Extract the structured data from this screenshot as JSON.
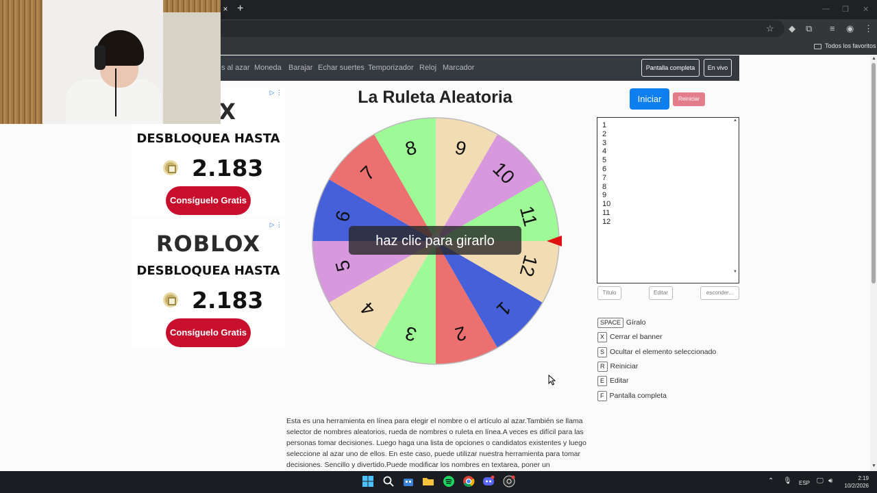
{
  "browser": {
    "new_tab": "+",
    "tab_close": "×",
    "bookmarks_folder": "Todos los favoritos"
  },
  "nav": {
    "links": [
      "s al azar",
      "Moneda",
      "Barajar",
      "Echar suertes",
      "Temporizador",
      "Reloj",
      "Marcador"
    ],
    "fullscreen": "Pantalla completa",
    "live": "En vivo"
  },
  "ads": [
    {
      "brand": "LOX",
      "headline": "DESBLOQUEA HASTA",
      "amount": "2.183",
      "cta": "Consíguelo Gratis"
    },
    {
      "brand": "ROBLOX",
      "headline": "DESBLOQUEA HASTA",
      "amount": "2.183",
      "cta": "Consíguelo Gratis"
    }
  ],
  "main": {
    "title": "La Ruleta Aleatoria",
    "start": "Iniciar",
    "reset": "Reiniciar",
    "overlay": "haz clic para girarlo",
    "entries_text": "1\n2\n3\n4\n5\n6\n7\n8\n9\n10\n11\n12",
    "title_btn": "Título",
    "edit_btn": "Editar",
    "hide_btn": "esconder..."
  },
  "wheel": {
    "segments": [
      {
        "label": "11",
        "color": "#9dfa96"
      },
      {
        "label": "12",
        "color": "#f1dcb4"
      },
      {
        "label": "1",
        "color": "#4560d8"
      },
      {
        "label": "2",
        "color": "#ec7070"
      },
      {
        "label": "3",
        "color": "#9dfa96"
      },
      {
        "label": "4",
        "color": "#f1dcb4"
      },
      {
        "label": "5",
        "color": "#d898de"
      },
      {
        "label": "6",
        "color": "#4560d8"
      },
      {
        "label": "7",
        "color": "#ec7070"
      },
      {
        "label": "8",
        "color": "#9dfa96"
      },
      {
        "label": "9",
        "color": "#f1dcb4"
      },
      {
        "label": "10",
        "color": "#d898de"
      }
    ],
    "pointer_color": "#e01010"
  },
  "shortcuts": [
    {
      "key": "SPACE",
      "label": "Gíralo"
    },
    {
      "key": "X",
      "label": "Cerrar el banner"
    },
    {
      "key": "S",
      "label": "Ocultar el elemento seleccionado"
    },
    {
      "key": "R",
      "label": "Reiniciar"
    },
    {
      "key": "E",
      "label": "Editar"
    },
    {
      "key": "F",
      "label": "Pantalla completa"
    }
  ],
  "description": "Esta es una herramienta en línea para elegir el nombre o el artículo al azar.También se llama selector de nombres aleatorios, rueda de nombres o ruleta en línea.A veces es difícil para las personas tomar decisiones. Luego haga una lista de opciones o candidatos existentes y luego seleccione al azar uno de ellos. En este caso, puede utilizar nuestra herramienta para tomar decisiones. Sencillo y divertido.Puede modificar los nombres en textarea, poner un",
  "taskbar": {
    "lang": "ESP",
    "time": "2:19",
    "date": "10/2/2026",
    "apps": [
      "windows-start",
      "search",
      "store",
      "file-explorer",
      "spotify",
      "chrome",
      "discord",
      "obs"
    ]
  }
}
